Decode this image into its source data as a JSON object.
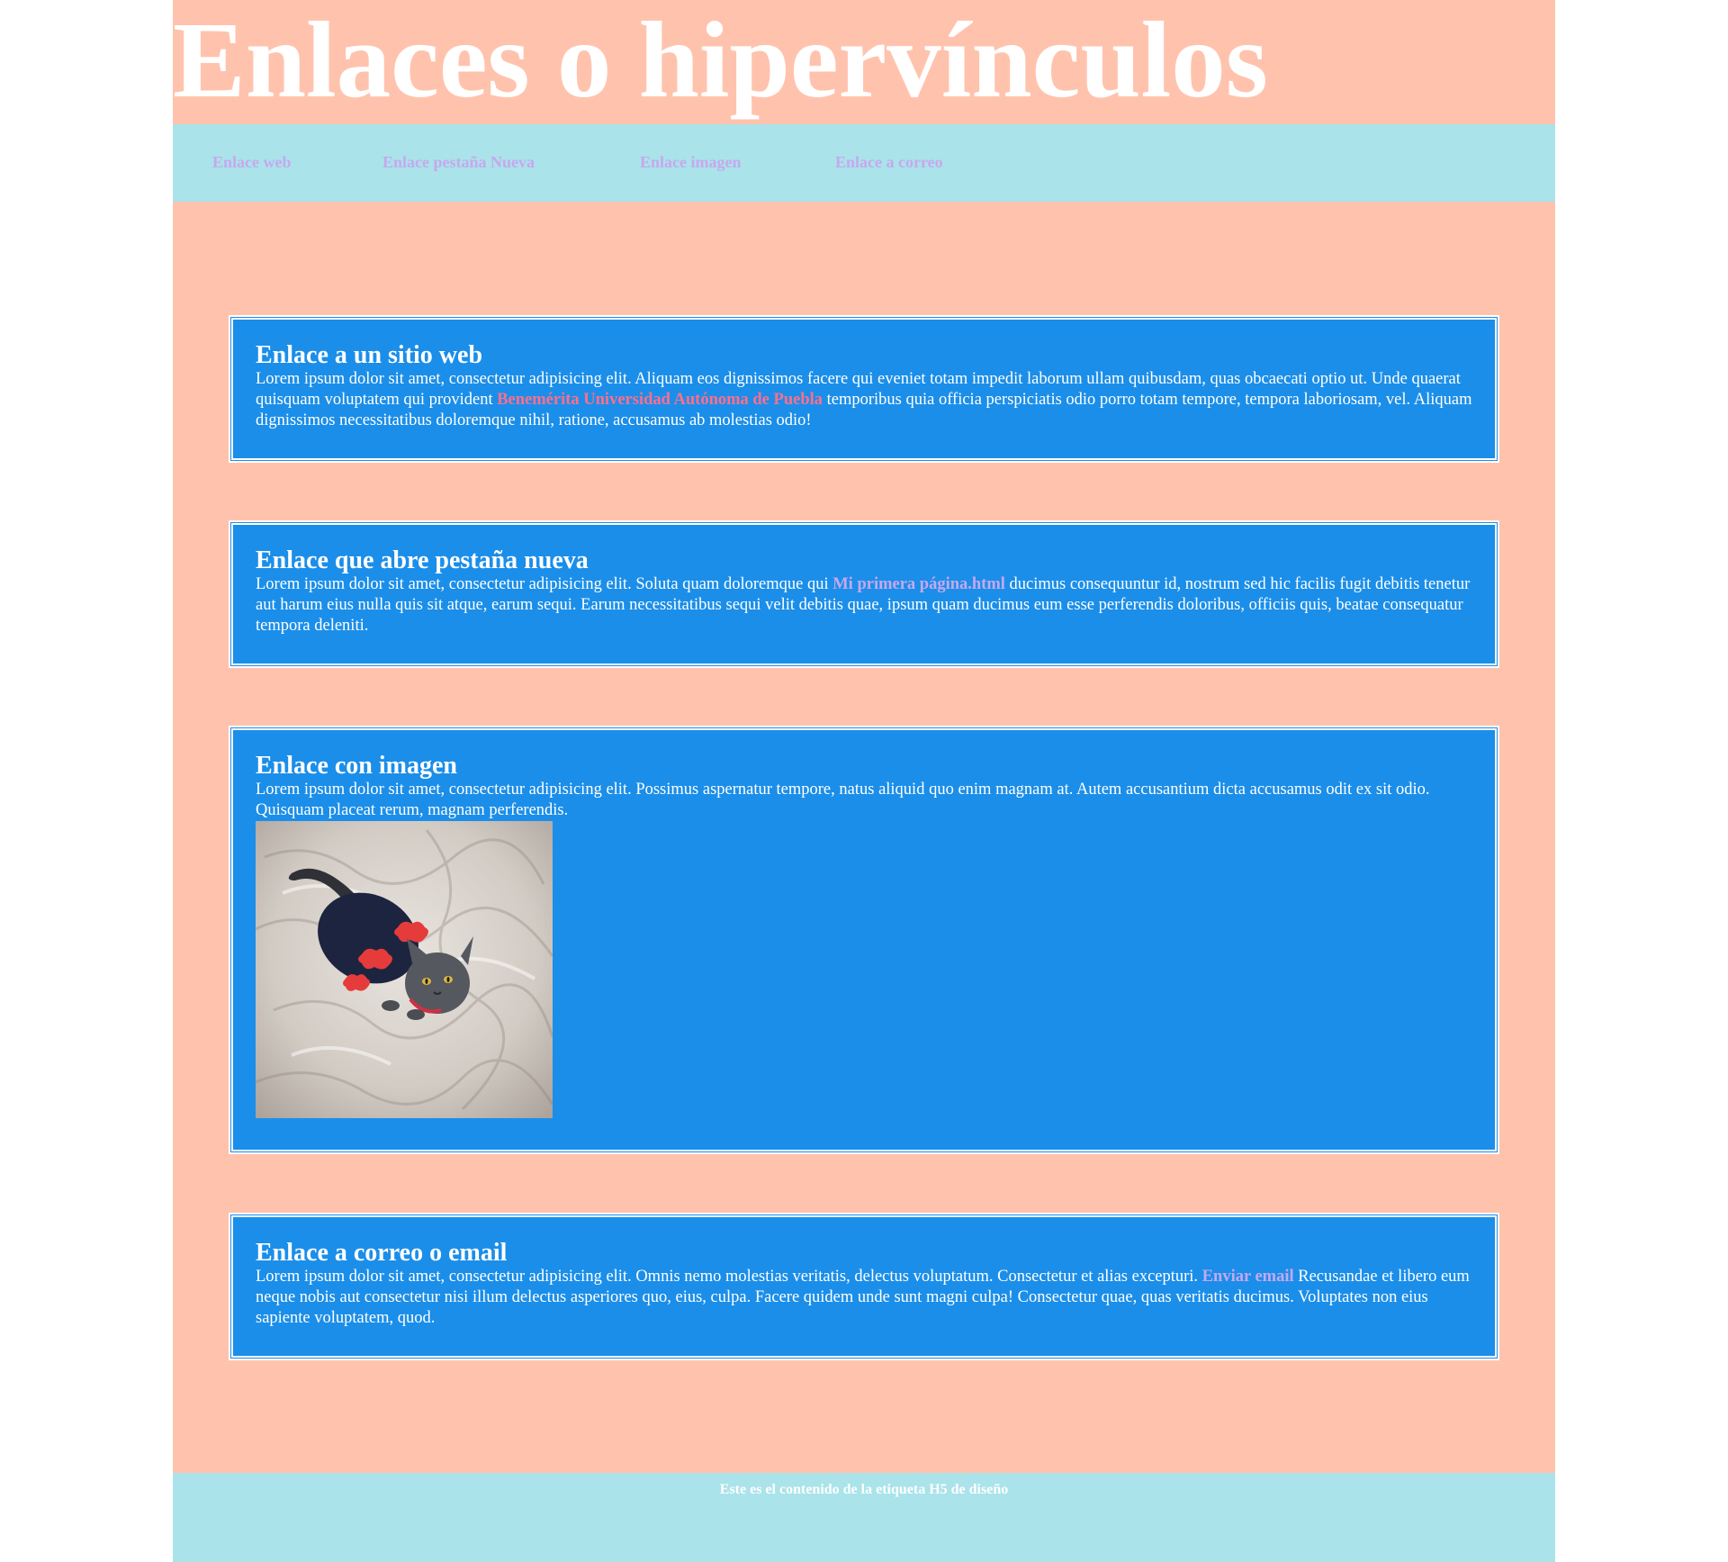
{
  "header": {
    "title": "Enlaces o hipervínculos"
  },
  "nav": {
    "items": [
      {
        "label": "Enlace web"
      },
      {
        "label": "Enlace pestaña Nueva"
      },
      {
        "label": "Enlace imagen"
      },
      {
        "label": "Enlace a correo"
      }
    ]
  },
  "sections": [
    {
      "heading": "Enlace a un sitio web",
      "text_before": "Lorem ipsum dolor sit amet, consectetur adipisicing elit. Aliquam eos dignissimos facere qui eveniet totam impedit laborum ullam quibusdam, quas obcaecati optio ut. Unde quaerat quisquam voluptatem qui provident ",
      "link": "Benemérita Universidad Autónoma de Puebla",
      "text_after": " temporibus quia officia perspiciatis odio porro totam tempore, tempora laboriosam, vel. Aliquam dignissimos necessitatibus doloremque nihil, ratione, accusamus ab molestias odio!"
    },
    {
      "heading": "Enlace que abre pestaña nueva",
      "text_before": "Lorem ipsum dolor sit amet, consectetur adipisicing elit. Soluta quam doloremque qui ",
      "link": "Mi primera página.html",
      "text_after": " ducimus consequuntur id, nostrum sed hic facilis fugit debitis tenetur aut harum eius nulla quis sit atque, earum sequi. Earum necessitatibus sequi velit debitis quae, ipsum quam ducimus eum esse perferendis doloribus, officiis quis, beatae consequatur tempora deleniti."
    },
    {
      "heading": "Enlace con imagen",
      "text": "Lorem ipsum dolor sit amet, consectetur adipisicing elit. Possimus aspernatur tempore, natus aliquid quo enim magnam at. Autem accusantium dicta accusamus odit ex sit odio. Quisquam placeat rerum, magnam perferendis."
    },
    {
      "heading": "Enlace a correo o email",
      "text_before": "Lorem ipsum dolor sit amet, consectetur adipisicing elit. Omnis nemo molestias veritatis, delectus voluptatum. Consectetur et alias excepturi. ",
      "link": "Enviar email",
      "text_after": " Recusandae et libero eum neque nobis aut consectetur nisi illum delectus asperiores quo, eius, culpa. Facere quidem unde sunt magni culpa! Consectetur quae, quas veritatis ducimus. Voluptates non eius sapiente voluptatem, quod."
    }
  ],
  "footer": {
    "text": "Este es el contenido de la etiqueta H5 de diseño"
  },
  "colors": {
    "page_background": "#ffc3ad",
    "nav_background": "#aae3ea",
    "card_background": "#1b8ee9",
    "link_pink": "#ff6f8c",
    "link_lilac": "#c7a8ee"
  }
}
